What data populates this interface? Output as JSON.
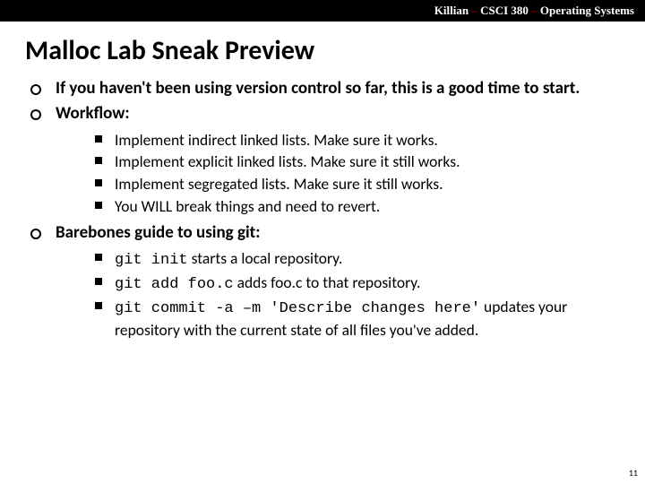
{
  "header": {
    "left": "Killian",
    "mid": "CSCI 380",
    "right": "Operating Systems"
  },
  "title": "Malloc Lab Sneak Preview",
  "bullets": {
    "b1": "If you haven't been using version control so far, this is a good time to start.",
    "b2": "Workflow:",
    "b2_sub": {
      "s1": "Implement indirect linked lists. Make sure it works.",
      "s2": "Implement explicit linked lists. Make sure it still works.",
      "s3": "Implement segregated lists. Make sure it still works.",
      "s4": "You WILL break things and need to revert."
    },
    "b3": "Barebones guide to using git:",
    "b3_sub": {
      "s1_code": "git init",
      "s1_rest": " starts a local repository.",
      "s2_code": "git add foo.c",
      "s2_rest": " adds foo.c to that repository.",
      "s3_code": "git commit -a –m 'Describe changes here'",
      "s3_rest": " updates your repository with the current state of all files you've added."
    }
  },
  "page_number": "11"
}
